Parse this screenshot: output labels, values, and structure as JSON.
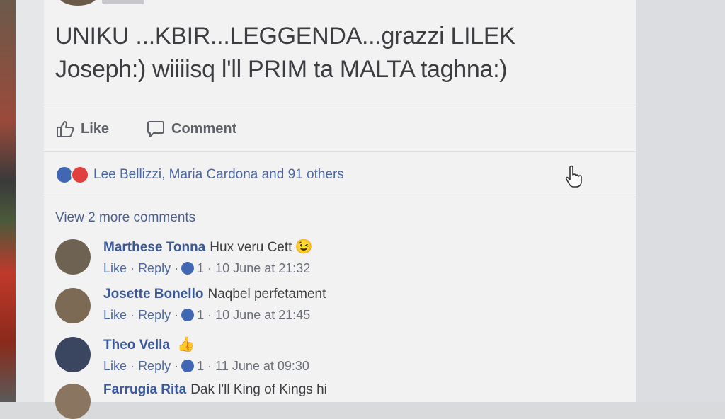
{
  "post": {
    "text": "UNIKU ...KBIR...LEGGENDA...grazzi LILEK Joseph:) wiiiisq l'll PRIM ta MALTA taghna:)"
  },
  "actions": {
    "like_label": "Like",
    "comment_label": "Comment"
  },
  "reactions": {
    "summary": "Lee Bellizzi, Maria Cardona and 91 others"
  },
  "comments_section": {
    "view_more_label": "View 2 more comments",
    "items": [
      {
        "author": "Marthese Tonna",
        "text": "Hux veru Cett",
        "emoji": "😉",
        "like": "Like",
        "reply": "Reply",
        "sep": "·",
        "likes": "1",
        "time": "10 June at 21:32"
      },
      {
        "author": "Josette Bonello",
        "text": "Naqbel perfetament",
        "emoji": "",
        "like": "Like",
        "reply": "Reply",
        "sep": "·",
        "likes": "1",
        "time": "10 June at 21:45"
      },
      {
        "author": "Theo Vella",
        "text": "",
        "emoji": "👍",
        "like": "Like",
        "reply": "Reply",
        "sep": "·",
        "likes": "1",
        "time": "11 June at 09:30"
      },
      {
        "author": "Farrugia Rita",
        "text": "Dak l'll King of Kings hi"
      }
    ]
  },
  "colors": {
    "link_blue": "#3b5998",
    "text_dark": "#3b3d40",
    "like_blue": "#4267b2",
    "love_red": "#e0413f"
  },
  "icons": [
    "thumbs-up-icon",
    "comment-bubble-icon",
    "like-reaction-icon",
    "love-reaction-icon",
    "hand-pointer-icon"
  ]
}
